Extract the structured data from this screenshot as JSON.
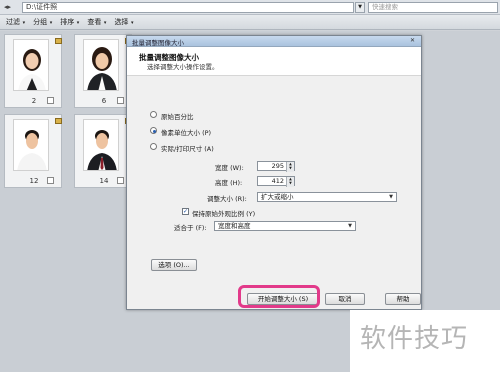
{
  "address": {
    "path": "D:\\证件照",
    "search_placeholder": "快速搜索"
  },
  "toolbar": {
    "items": [
      {
        "label": "过滤",
        "has_arrow": true
      },
      {
        "label": "分组",
        "has_arrow": true
      },
      {
        "label": "排序",
        "has_arrow": true
      },
      {
        "label": "查看",
        "has_arrow": true
      },
      {
        "label": "选择",
        "has_arrow": true
      }
    ]
  },
  "thumbnails": [
    {
      "caption": "2",
      "bg": "#cc2a2a"
    },
    {
      "caption": "6",
      "bg": "#fbfbfb"
    },
    {
      "caption": "12",
      "bg": "#2f6fb7"
    },
    {
      "caption": "14",
      "bg": "#2f6fb7"
    }
  ],
  "dialog": {
    "title": "批量调整图像大小",
    "close": "✕",
    "heading": "批量调整图像大小",
    "subheading": "选择调整大小操作设置。",
    "options": {
      "percent": "原始百分比",
      "pixels": "像素单位大小 (P)",
      "print": "实际/打印尺寸 (A)",
      "selected": "pixels"
    },
    "width_label": "宽度 (W):",
    "width_value": "295",
    "height_label": "高度 (H):",
    "height_value": "412",
    "resize_label": "调整大小 (R):",
    "resize_value": "扩大或缩小",
    "keep_ratio_label": "保持原始外观比例 (Y)",
    "keep_ratio_checked": true,
    "fit_label": "适合于 (F):",
    "fit_value": "宽度和高度",
    "options_button": "选项 (O)...",
    "start_button": "开始调整大小 (S)",
    "cancel_button": "取消",
    "help_button": "帮助"
  },
  "watermark": {
    "text": "软件技巧"
  },
  "colors": {
    "highlight": "#e23a8a",
    "title_bar": "#aac3de"
  }
}
